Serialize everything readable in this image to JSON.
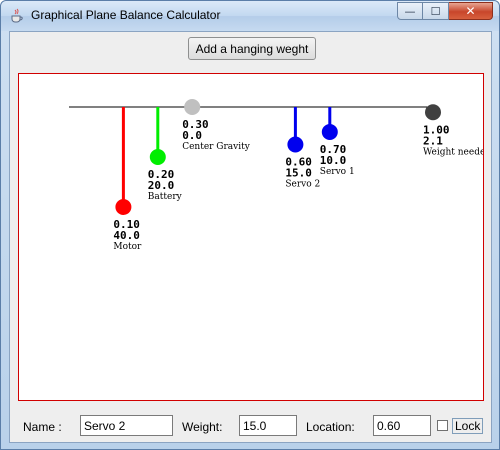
{
  "window": {
    "title": "Graphical Plane Balance Calculator",
    "minimize_glyph": "—",
    "maximize_glyph": "☐",
    "close_glyph": "✕"
  },
  "toolbar": {
    "add_button_label": "Add a hanging weght"
  },
  "canvas": {
    "beam_color": "#000000",
    "frame_color": "#d10000",
    "weights": [
      {
        "name": "Motor",
        "location": "0.10",
        "weight": "40.0",
        "color": "#ff0000"
      },
      {
        "name": "Battery",
        "location": "0.20",
        "weight": "20.0",
        "color": "#00ee00"
      },
      {
        "name": "Center Gravity",
        "location": "0.30",
        "weight": "0.0",
        "color": "#c0c0c0"
      },
      {
        "name": "Servo 2",
        "location": "0.60",
        "weight": "15.0",
        "color": "#0000ee"
      },
      {
        "name": "Servo 1",
        "location": "0.70",
        "weight": "10.0",
        "color": "#0000ee"
      },
      {
        "name": "Weight needed",
        "location": "1.00",
        "weight": "2.1",
        "color": "#404040"
      }
    ]
  },
  "form": {
    "name_label": "Name :",
    "name_value": "Servo 2",
    "weight_label": "Weight:",
    "weight_value": "15.0",
    "location_label": "Location:",
    "location_value": "0.60",
    "lock_label": "Lock",
    "lock_checked": false
  }
}
